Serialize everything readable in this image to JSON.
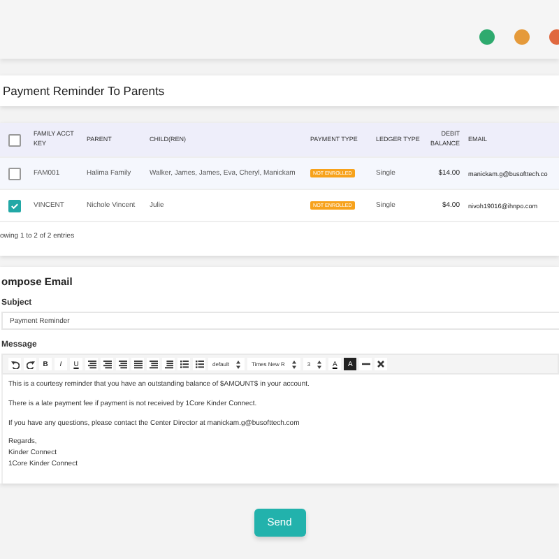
{
  "header": {
    "status_dots": [
      {
        "color": "#2eaa6e"
      },
      {
        "color": "#e59a3a"
      },
      {
        "color": "#e0683f"
      }
    ]
  },
  "page_title": "Payment Reminder To Parents",
  "table": {
    "select_all": {
      "checked": false
    },
    "columns": [
      "FAMILY ACCT KEY",
      "PARENT",
      "CHILD(REN)",
      "PAYMENT TYPE",
      "LEDGER TYPE",
      "DEBIT BALANCE",
      "EMAIL"
    ],
    "rows": [
      {
        "checked": false,
        "key": "FAM001",
        "parent": "Halima Family",
        "children": "Walker, James, James, Eva, Cheryl, Manickam",
        "payment_type": "NOT ENROLLED",
        "ledger_type": "Single",
        "debit_balance": "$14.00",
        "email": "manickam.g@busofttech.co"
      },
      {
        "checked": true,
        "key": "VINCENT",
        "parent": "Nichole Vincent",
        "children": "Julie",
        "payment_type": "NOT ENROLLED",
        "ledger_type": "Single",
        "debit_balance": "$4.00",
        "email": "nivoh19016@ihnpo.com"
      }
    ],
    "info": "owing 1 to 2 of 2 entries"
  },
  "compose": {
    "title": "ompose Email",
    "subject_label": "Subject",
    "subject": "Payment Reminder",
    "message_label": "Message",
    "toolbar": [
      {
        "kind": "undo"
      },
      {
        "kind": "redo"
      },
      {
        "kind": "bold",
        "label": "B"
      },
      {
        "kind": "italic",
        "label": "I"
      },
      {
        "kind": "underline",
        "label": "U"
      },
      {
        "kind": "alignleft"
      },
      {
        "kind": "aligncenter"
      },
      {
        "kind": "alignright"
      },
      {
        "kind": "justify"
      },
      {
        "kind": "indent"
      },
      {
        "kind": "outdent"
      },
      {
        "kind": "bullets"
      },
      {
        "kind": "numbers"
      },
      {
        "kind": "select",
        "label": "default"
      },
      {
        "kind": "select",
        "label": "Times New R"
      },
      {
        "kind": "select",
        "label": "3"
      },
      {
        "kind": "forecolor",
        "label": "A"
      },
      {
        "kind": "backcolor",
        "label": "A"
      },
      {
        "kind": "rule"
      },
      {
        "kind": "clear"
      }
    ],
    "paragraphs": [
      [
        "This is a courtesy reminder that you have an outstanding balance of $AMOUNT$ in your account."
      ],
      [
        "There is a late payment fee if payment is not received by 1Core Kinder Connect."
      ],
      [
        "If you have any questions, please contact the Center Director at manickam.g@busofttech.com"
      ],
      [
        "Regards,",
        "Kinder Connect",
        "1Core Kinder Connect"
      ]
    ],
    "send": "Send"
  }
}
